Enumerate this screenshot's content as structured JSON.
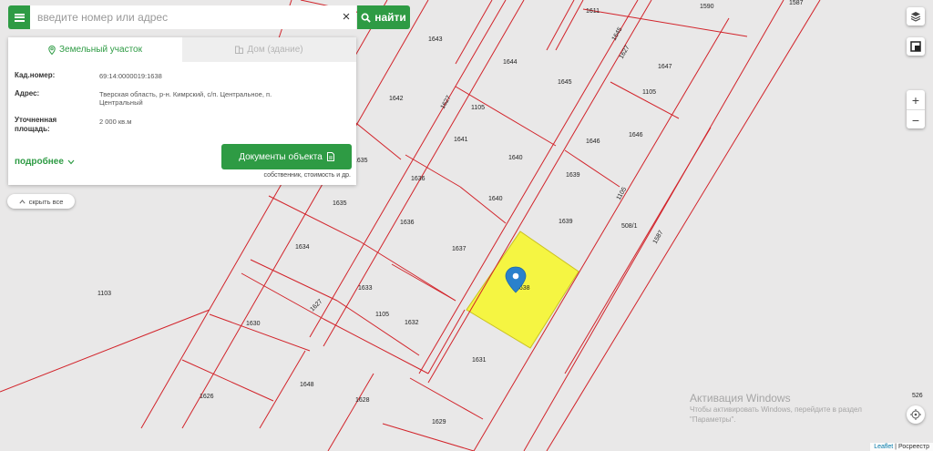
{
  "search": {
    "placeholder": "введите номер или адрес",
    "clear_label": "×",
    "find_label": "найти"
  },
  "panel": {
    "tabs": [
      {
        "label": "Земельный участок",
        "active": true
      },
      {
        "label": "Дом (здание)",
        "active": false
      }
    ],
    "fields": [
      {
        "label": "Кад.номер:",
        "value": "69:14:0000019:1638"
      },
      {
        "label": "Адрес:",
        "value": "Тверская область, р-н. Кимрский, с/п. Центральное, п. Центральный"
      },
      {
        "label_line1": "Уточненная",
        "label_line2": "площадь:",
        "value": "2 000 кв.м"
      }
    ],
    "more_label": "подробнее",
    "docs_button": "Документы объекта",
    "docs_sub": "собственник, стоимость и др."
  },
  "hide_all_label": "скрыть все",
  "map": {
    "parcel_labels": [
      "1611",
      "1590",
      "1587",
      "1643",
      "1644",
      "1645",
      "1647",
      "1105",
      "1642",
      "1627",
      "1105",
      "1645",
      "1627",
      "1641",
      "1640",
      "1646",
      "1646",
      "1636",
      "1639",
      "1105",
      "1635",
      "1635",
      "1636",
      "1640",
      "508/1",
      "1639",
      "1587",
      "1634",
      "1637",
      "1103",
      "1633",
      "1627",
      "1105",
      "1632",
      "1630",
      "1631",
      "1648",
      "1626",
      "1628",
      "1629",
      "526"
    ],
    "selected_parcel": "1638",
    "selected_color": "#f5f542",
    "line_color": "#d2232a"
  },
  "controls": {
    "zoom_in": "+",
    "zoom_out": "−"
  },
  "attribution": {
    "leaflet": "Leaflet",
    "separator": " | ",
    "source": "Росреестр"
  },
  "watermark": {
    "title": "Активация Windows",
    "line1": "Чтобы активировать Windows, перейдите в раздел",
    "line2": "\"Параметры\"."
  },
  "colors": {
    "accent": "#2e9b44",
    "map_bg": "#e9e8e8"
  }
}
